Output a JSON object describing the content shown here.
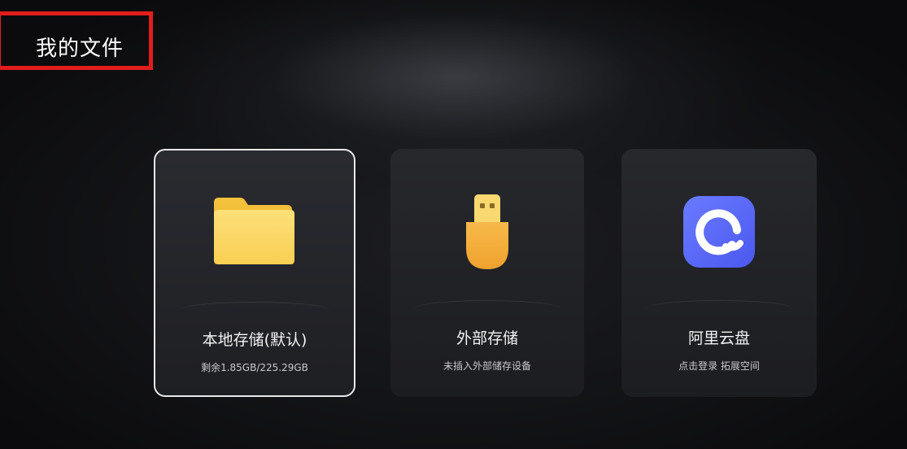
{
  "page_title": "我的文件",
  "highlight_color": "#e21d1d",
  "cards": [
    {
      "label": "本地存储(默认)",
      "sub": "剩余1.85GB/225.29GB",
      "icon": "folder-icon",
      "icon_color": "#f7cf4e",
      "selected": true
    },
    {
      "label": "外部存储",
      "sub": "未插入外部储存设备",
      "icon": "usb-drive-icon",
      "icon_color": "#f5b43c",
      "selected": false
    },
    {
      "label": "阿里云盘",
      "sub": "点击登录 拓展空间",
      "icon": "aliyun-drive-icon",
      "icon_color": "#5b6cf6",
      "selected": false
    }
  ]
}
